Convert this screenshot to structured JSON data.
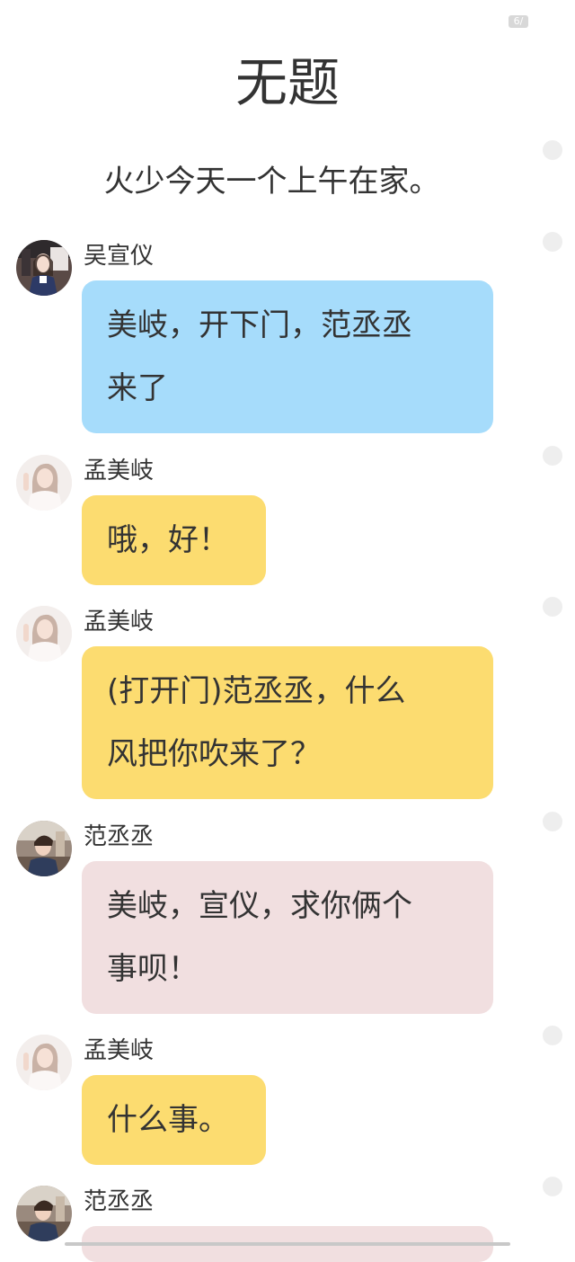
{
  "badge": "6/",
  "title": "无题",
  "intro": "火少今天一个上午在家。",
  "messages": [
    {
      "name": "吴宣仪",
      "text": "美岐，开下门，范丞丞\n来了",
      "color": "blue"
    },
    {
      "name": "孟美岐",
      "text": "哦，好！",
      "color": "yellow"
    },
    {
      "name": "孟美岐",
      "text": "(打开门)范丞丞，什么\n风把你吹来了？",
      "color": "yellow"
    },
    {
      "name": "范丞丞",
      "text": "美岐，宣仪，求你俩个\n事呗！",
      "color": "pink"
    },
    {
      "name": "孟美岐",
      "text": "什么事。",
      "color": "yellow"
    },
    {
      "name": "范丞丞",
      "text": "",
      "color": "pink"
    }
  ],
  "colors": {
    "blue_bubble": "#a6dcfb",
    "yellow_bubble": "#fcdc70",
    "pink_bubble": "#f1dfe0"
  }
}
